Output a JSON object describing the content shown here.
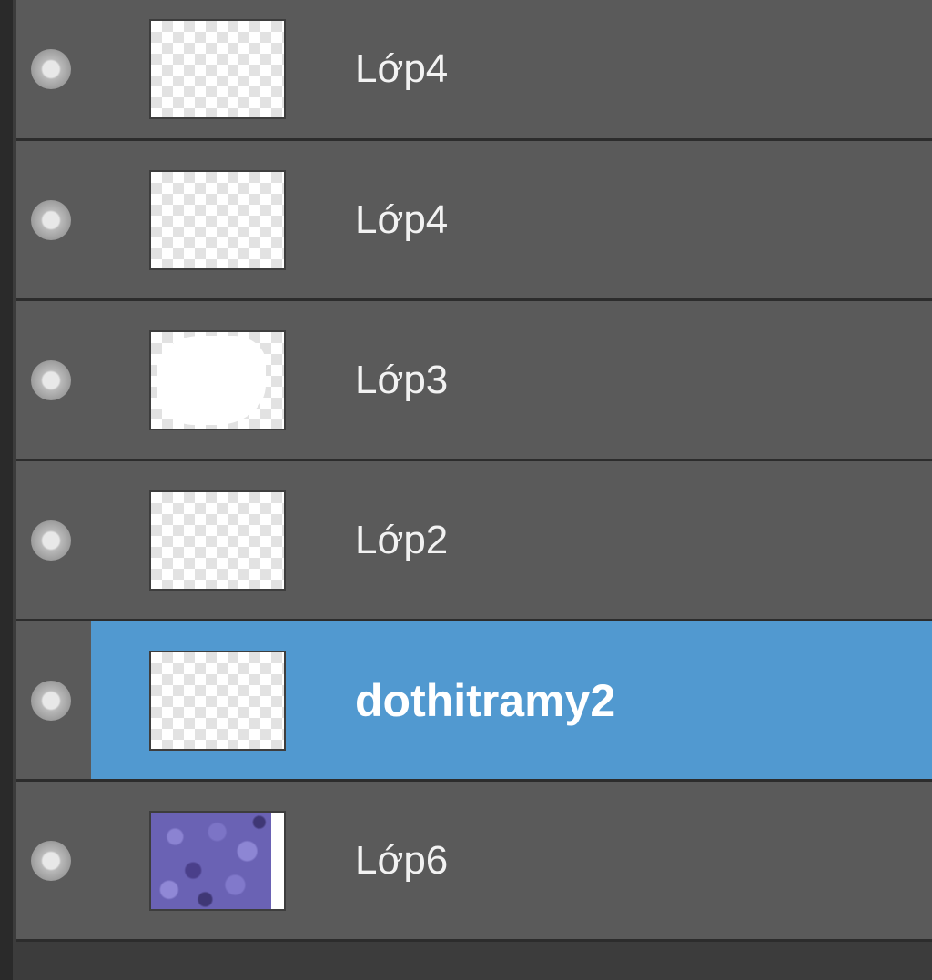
{
  "layers_panel": {
    "layers": [
      {
        "name": "Lớp4",
        "visible": true,
        "thumbnail": "transparent",
        "selected": false
      },
      {
        "name": "Lớp4",
        "visible": true,
        "thumbnail": "transparent",
        "selected": false
      },
      {
        "name": "Lớp3",
        "visible": true,
        "thumbnail": "white-shape",
        "selected": false
      },
      {
        "name": "Lớp2",
        "visible": true,
        "thumbnail": "transparent",
        "selected": false
      },
      {
        "name": "dothitramy2",
        "visible": true,
        "thumbnail": "transparent",
        "selected": true
      },
      {
        "name": "Lớp6",
        "visible": true,
        "thumbnail": "purple-flowers",
        "selected": false
      }
    ],
    "icons": {
      "visibility": "eye-icon"
    },
    "colors": {
      "row_background": "#5a5a5a",
      "selected_background": "#5199d0",
      "divider": "#2c2c2c",
      "text": "#f2f2f2"
    }
  }
}
